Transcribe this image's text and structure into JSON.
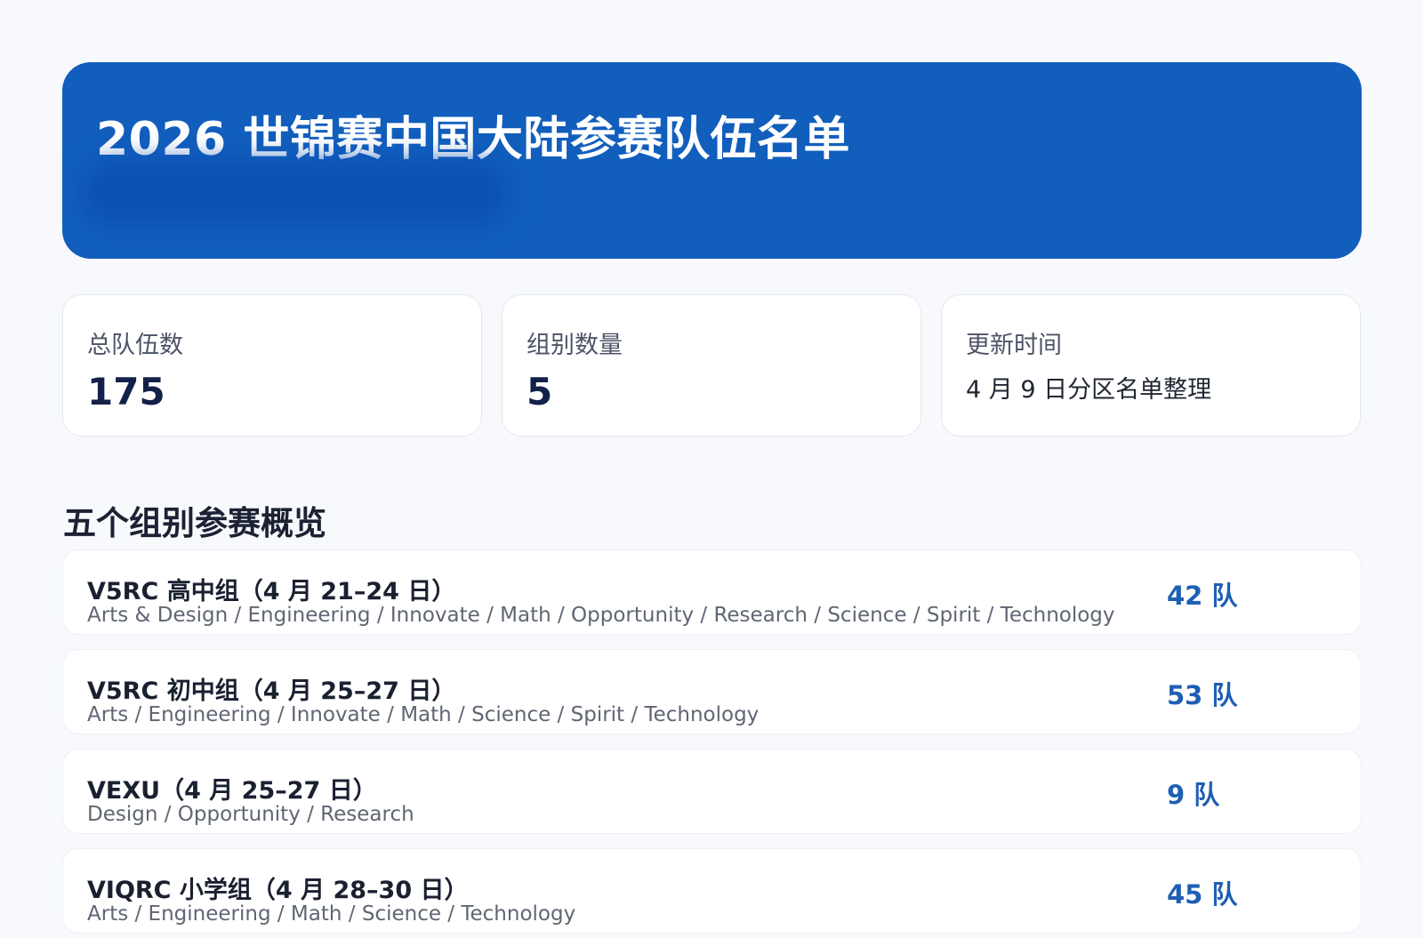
{
  "header": {
    "title": "2026 世锦赛中国大陆参赛队伍名单"
  },
  "stats": [
    {
      "label": "总队伍数",
      "value": "175"
    },
    {
      "label": "组别数量",
      "value": "5"
    },
    {
      "label": "更新时间",
      "value": "4 月 9 日分区名单整理"
    }
  ],
  "overview": {
    "title": "五个组别参赛概览",
    "groups": [
      {
        "name": "V5RC 高中组（4 月 21–24 日）",
        "categories": "Arts & Design / Engineering / Innovate / Math / Opportunity / Research / Science / Spirit / Technology",
        "count": "42 队"
      },
      {
        "name": "V5RC 初中组（4 月 25–27 日）",
        "categories": "Arts / Engineering / Innovate / Math / Science / Spirit / Technology",
        "count": "53 队"
      },
      {
        "name": "VEXU（4 月 25–27 日）",
        "categories": "Design / Opportunity / Research",
        "count": "9 队"
      },
      {
        "name": "VIQRC 小学组（4 月 28–30 日）",
        "categories": "Arts / Engineering / Math / Science / Technology",
        "count": "45 队"
      }
    ]
  },
  "colors": {
    "hero_background": "#115ebd",
    "page_background": "#f7f9fc",
    "count_accent": "#1e5fb4"
  }
}
